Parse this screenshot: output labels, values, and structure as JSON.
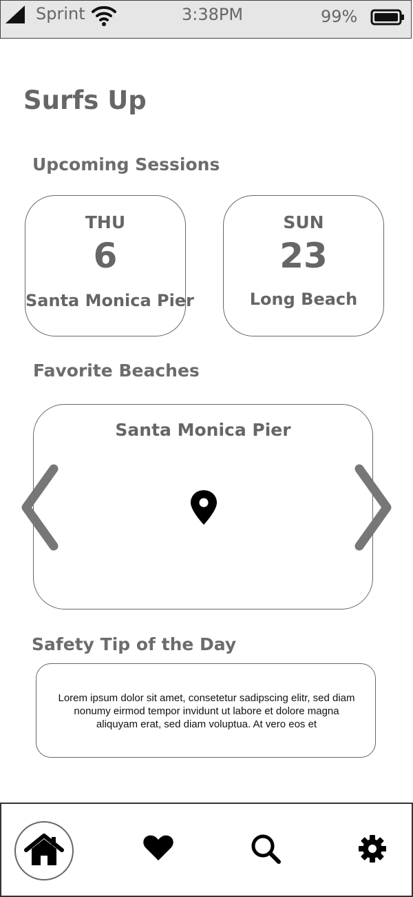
{
  "status_bar": {
    "carrier": "Sprint",
    "time": "3:38PM",
    "battery": "99%"
  },
  "app": {
    "title": "Surfs Up"
  },
  "sessions": {
    "heading": "Upcoming Sessions",
    "items": [
      {
        "day": "THU",
        "date": "6",
        "place": "Santa Monica Pier"
      },
      {
        "day": "SUN",
        "date": "23",
        "place": "Long Beach"
      }
    ]
  },
  "favorites": {
    "heading": "Favorite Beaches",
    "current": "Santa Monica Pier",
    "icon": "map-pin-icon"
  },
  "safety": {
    "heading": "Safety Tip of the Day",
    "text": "Lorem ipsum dolor sit amet, consetetur sadipscing elitr, sed diam nonumy eirmod tempor invidunt ut labore et dolore magna aliquyam erat, sed diam voluptua. At vero eos et"
  },
  "tabbar": {
    "items": [
      {
        "icon": "home-icon",
        "active": true
      },
      {
        "icon": "heart-icon",
        "active": false
      },
      {
        "icon": "search-icon",
        "active": false
      },
      {
        "icon": "gear-icon",
        "active": false
      }
    ]
  }
}
